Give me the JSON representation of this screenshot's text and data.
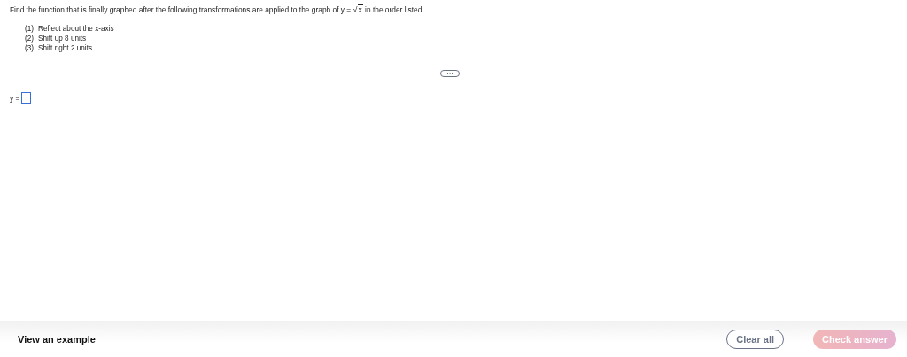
{
  "question": {
    "before": "Find the function that is finally graphed after the following transformations are applied to the graph of y =",
    "radical": "√",
    "radicand": "x",
    "after": "in the order listed."
  },
  "steps": [
    {
      "number": "(1)",
      "text": "Reflect about the x-axis"
    },
    {
      "number": "(2)",
      "text": "Shift up 8 units"
    },
    {
      "number": "(3)",
      "text": "Shift right 2 units"
    }
  ],
  "divider_handle": "···",
  "answer": {
    "label": "y ="
  },
  "footer": {
    "example_link": "View an example",
    "buttons": [
      {
        "label": "Clear all",
        "kind": "outline",
        "disabled": false
      },
      {
        "label": "Check answer",
        "kind": "primary",
        "disabled": true
      }
    ]
  }
}
